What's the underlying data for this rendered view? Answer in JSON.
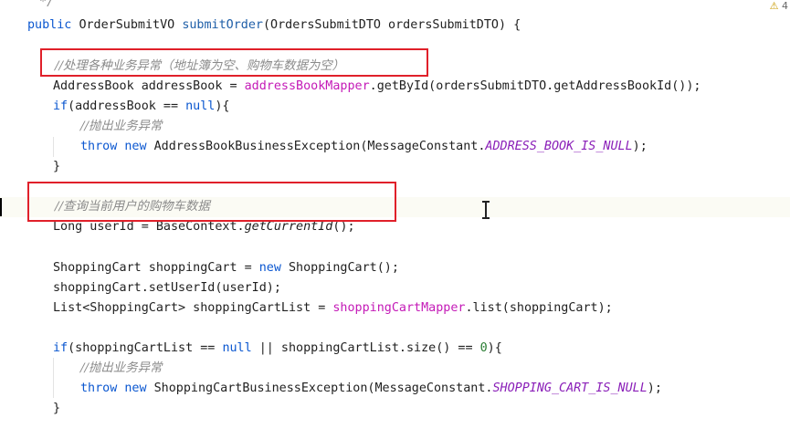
{
  "editor": {
    "warning_count": "4",
    "lines": [
      {
        "id": "l0",
        "tokens": [
          {
            "t": " */",
            "c": "comment"
          }
        ]
      },
      {
        "id": "l1",
        "tokens": [
          {
            "t": "public ",
            "c": "kw"
          },
          {
            "t": "OrderSubmitVO "
          },
          {
            "t": "submitOrder",
            "c": "fn"
          },
          {
            "t": "(OrdersSubmitDTO ordersSubmitDTO) {"
          }
        ]
      },
      {
        "id": "l2",
        "tokens": []
      },
      {
        "id": "l3",
        "tokens": [
          {
            "t": "//处理各种业务异常（地址簿为空、购物车数据为空）",
            "c": "comment cn"
          }
        ]
      },
      {
        "id": "l4",
        "tokens": [
          {
            "t": "AddressBook addressBook = "
          },
          {
            "t": "addressBookMapper",
            "c": "field"
          },
          {
            "t": ".getById(ordersSubmitDTO.getAddressBookId());"
          }
        ]
      },
      {
        "id": "l5",
        "tokens": [
          {
            "t": "if",
            "c": "kw"
          },
          {
            "t": "(addressBook == "
          },
          {
            "t": "null",
            "c": "kw"
          },
          {
            "t": "){"
          }
        ]
      },
      {
        "id": "l6",
        "tokens": [
          {
            "t": "//抛出业务异常",
            "c": "comment cn"
          }
        ]
      },
      {
        "id": "l7",
        "tokens": [
          {
            "t": "throw ",
            "c": "kw"
          },
          {
            "t": "new ",
            "c": "kw"
          },
          {
            "t": "AddressBookBusinessException(MessageConstant."
          },
          {
            "t": "ADDRESS_BOOK_IS_NULL",
            "c": "const"
          },
          {
            "t": ");"
          }
        ]
      },
      {
        "id": "l8",
        "tokens": [
          {
            "t": "}"
          }
        ]
      },
      {
        "id": "l9",
        "tokens": []
      },
      {
        "id": "l10",
        "tokens": [
          {
            "t": "//查询当前用户的购物车数据",
            "c": "comment cn"
          }
        ]
      },
      {
        "id": "l11",
        "tokens": [
          {
            "t": "Long userId = BaseContext."
          },
          {
            "t": "getCurrentId",
            "c": "static"
          },
          {
            "t": "();"
          }
        ]
      },
      {
        "id": "l12",
        "tokens": []
      },
      {
        "id": "l13",
        "tokens": [
          {
            "t": "ShoppingCart shoppingCart = "
          },
          {
            "t": "new ",
            "c": "kw"
          },
          {
            "t": "ShoppingCart();"
          }
        ]
      },
      {
        "id": "l14",
        "tokens": [
          {
            "t": "shoppingCart.setUserId(userId);"
          }
        ]
      },
      {
        "id": "l15",
        "tokens": [
          {
            "t": "List<ShoppingCart> shoppingCartList = "
          },
          {
            "t": "shoppingCartMapper",
            "c": "field"
          },
          {
            "t": ".list(shoppingCart);"
          }
        ]
      },
      {
        "id": "l16",
        "tokens": []
      },
      {
        "id": "l17",
        "tokens": [
          {
            "t": "if",
            "c": "kw"
          },
          {
            "t": "(shoppingCartList == "
          },
          {
            "t": "null",
            "c": "kw"
          },
          {
            "t": " || shoppingCartList.size() == "
          },
          {
            "t": "0",
            "c": "num"
          },
          {
            "t": "){"
          }
        ]
      },
      {
        "id": "l18",
        "tokens": [
          {
            "t": "//抛出业务异常",
            "c": "comment cn"
          }
        ]
      },
      {
        "id": "l19",
        "tokens": [
          {
            "t": "throw ",
            "c": "kw"
          },
          {
            "t": "new ",
            "c": "kw"
          },
          {
            "t": "ShoppingCartBusinessException(MessageConstant."
          },
          {
            "t": "SHOPPING_CART_IS_NULL",
            "c": "const"
          },
          {
            "t": ");"
          }
        ]
      },
      {
        "id": "l20",
        "tokens": [
          {
            "t": "}"
          }
        ]
      }
    ]
  }
}
